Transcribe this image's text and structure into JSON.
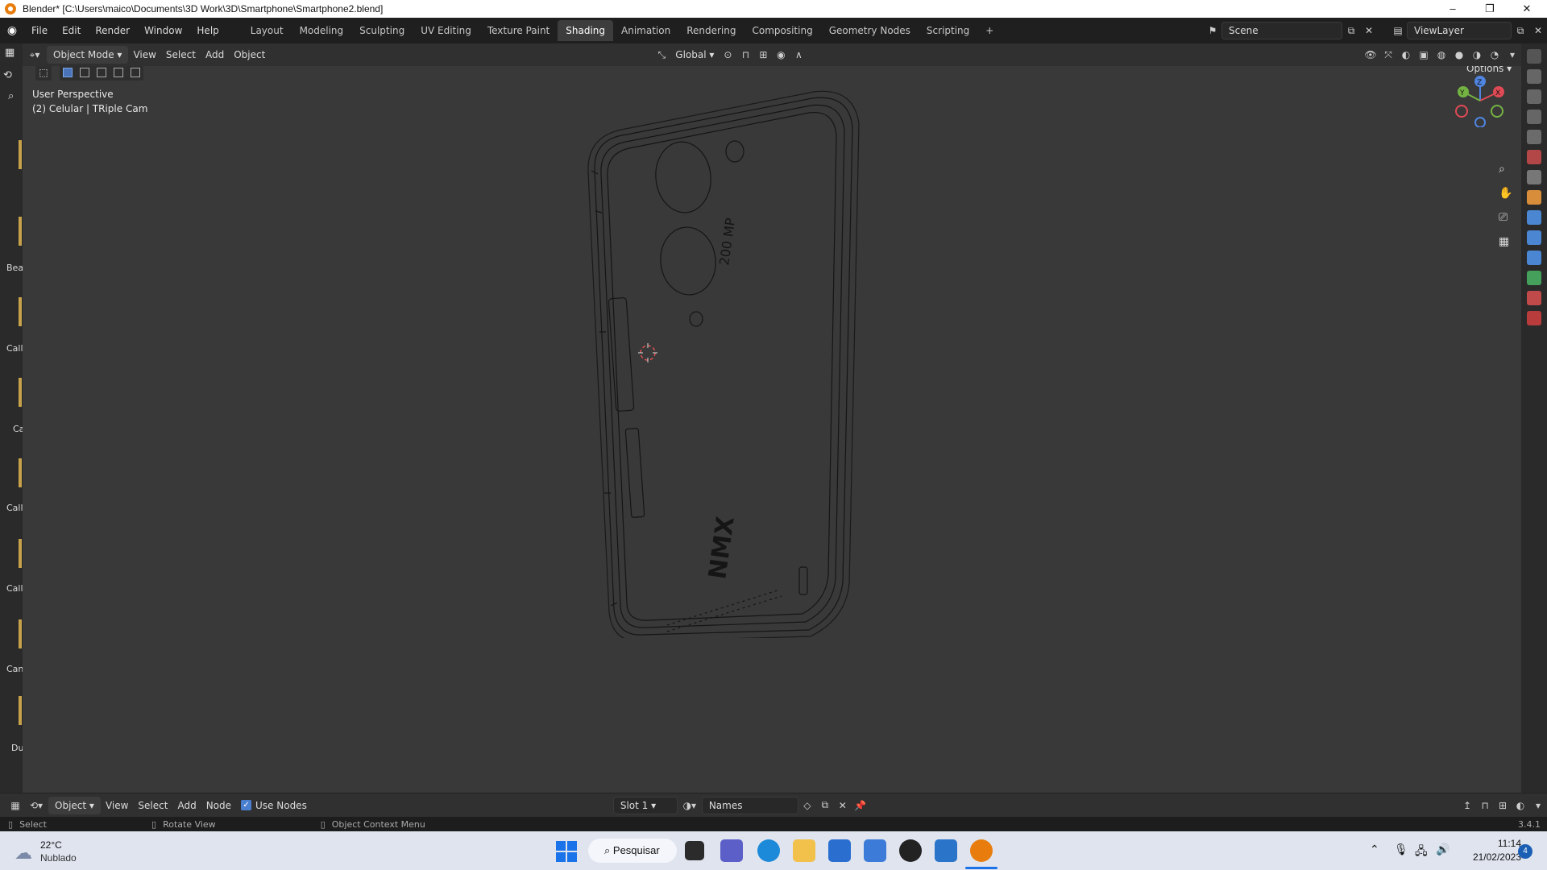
{
  "window": {
    "title": "Blender* [C:\\Users\\maico\\Documents\\3D Work\\3D\\Smartphone\\Smartphone2.blend]",
    "controls": [
      "–",
      "❐",
      "✕"
    ]
  },
  "menu": [
    "File",
    "Edit",
    "Render",
    "Window",
    "Help"
  ],
  "workspaces": [
    "Layout",
    "Modeling",
    "Sculpting",
    "UV Editing",
    "Texture Paint",
    "Shading",
    "Animation",
    "Rendering",
    "Compositing",
    "Geometry Nodes",
    "Scripting"
  ],
  "active_workspace": "Shading",
  "scene_field": "Scene",
  "viewlayer_field": "ViewLayer",
  "viewport_header": {
    "mode": "Object Mode",
    "menus": [
      "View",
      "Select",
      "Add",
      "Object"
    ],
    "transform": "Global",
    "options": "Options"
  },
  "viewport": {
    "perspective": "User Perspective",
    "object_info": "(2) Celular | TRiple Cam",
    "gizmo_axes": [
      "X",
      "Y",
      "Z"
    ]
  },
  "phone_labels": {
    "camera_text": "200 MP",
    "brand_text": "NMX"
  },
  "left_panel_labels": [
    "Bea",
    "Call",
    "Ca",
    "Call",
    "Call",
    "Can",
    "Du"
  ],
  "node_header": {
    "mode": "Object",
    "menus": [
      "View",
      "Select",
      "Add",
      "Node"
    ],
    "use_nodes_label": "Use Nodes",
    "use_nodes_checked": true,
    "slot": "Slot 1",
    "material_name": "Names"
  },
  "status_bar": {
    "items": [
      "Select",
      "Rotate View",
      "Object Context Menu"
    ],
    "version": "3.4.1"
  },
  "taskbar": {
    "weather_temp": "22°C",
    "weather_desc": "Nublado",
    "search": "Pesquisar",
    "time": "11:14",
    "date": "21/02/2023",
    "notifications": "4"
  },
  "colors": {
    "accent": "#e87d0d",
    "active_tab": "#3d3d3d",
    "viewport_bg": "#393939"
  }
}
